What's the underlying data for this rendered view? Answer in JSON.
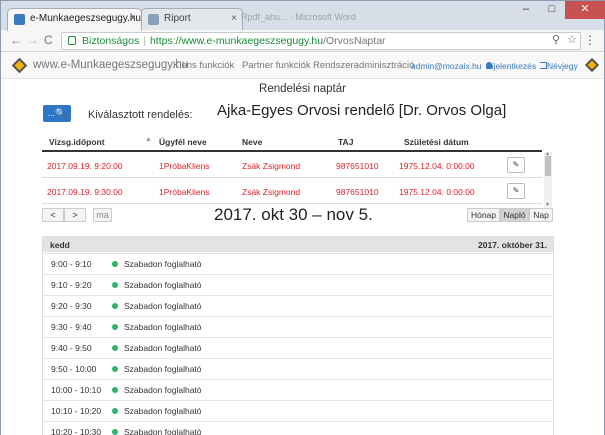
{
  "browser": {
    "tabs": [
      {
        "label": "e-Munkaegeszsegugy.hu",
        "close": "×",
        "favicon_color": "#3a7bbf"
      },
      {
        "label": "Riport",
        "close": "×",
        "favicon_color": "#8aa0b8"
      }
    ],
    "ghost_tabs_text": "Rpdf_ahu... - Microsoft Word",
    "window_buttons": {
      "minimize": "–",
      "maximize": "□",
      "close": "✕"
    },
    "nav": {
      "back": "←",
      "forward": "→",
      "reload": "C"
    },
    "address": {
      "secure_label": "Biztonságos",
      "separator": "|",
      "host": "https://www.e-munkaegeszsegugy.hu",
      "path": "/OrvosNaptar"
    },
    "omnibox_icons": {
      "search": "⚲",
      "star": "☆"
    },
    "menu": "⋮"
  },
  "navbar": {
    "brand": "www.e-Munkaegeszsegugy.hu",
    "links": [
      "Klens funkciók",
      "Partner funkciók",
      "Rendszeradminisztráció"
    ],
    "user": "admin@mozaix.hu",
    "logout": "Kijelentkezés",
    "card": "Névjegy"
  },
  "page": {
    "title": "Rendelési naptár",
    "search_button": "...🔍",
    "selected_label": "Kiválasztott rendelés:",
    "selected_value": "Ajka-Egyes Orvosi rendelő [Dr. Orvos Olga]"
  },
  "table": {
    "sort_indicator": "▲",
    "headers": [
      "Vizsg.időpont",
      "Ügyfél neve",
      "Neve",
      "TAJ",
      "Születési dátum"
    ],
    "rows": [
      {
        "time": "2017.09.19. 9:20:00",
        "client": "1PróbaKliens",
        "name": "Zsák Zsigmond",
        "taj": "987651010",
        "birth": "1975.12.04. 0:00:00",
        "edit": "✎"
      },
      {
        "time": "2017.09.19. 9:30:00",
        "client": "1PróbaKliens",
        "name": "Zsák Zsigmond",
        "taj": "987651010",
        "birth": "1975.12.04. 0:00:00",
        "edit": "✎"
      }
    ],
    "scroll_up": "▲",
    "scroll_down": "▼"
  },
  "calendar": {
    "prev": "<",
    "next": ">",
    "today": "ma",
    "title": "2017. okt 30 – nov 5.",
    "views": [
      "Hónap",
      "Napló",
      "Nap"
    ],
    "active_view": "Napló",
    "day_name": "kedd",
    "day_date": "2017. október 31.",
    "slots": [
      {
        "time": "9:00 - 9:10",
        "status": "Szabadon foglalható"
      },
      {
        "time": "9:10 - 9:20",
        "status": "Szabadon foglalható"
      },
      {
        "time": "9:20 - 9:30",
        "status": "Szabadon foglalható"
      },
      {
        "time": "9:30 - 9:40",
        "status": "Szabadon foglalható"
      },
      {
        "time": "9:40 - 9:50",
        "status": "Szabadon foglalható"
      },
      {
        "time": "9:50 - 10:00",
        "status": "Szabadon foglalható"
      },
      {
        "time": "10:00 - 10:10",
        "status": "Szabadon foglalható"
      },
      {
        "time": "10:10 - 10:20",
        "status": "Szabadon foglalható"
      },
      {
        "time": "10:20 - 10:30",
        "status": "Szabadon foglalható"
      }
    ],
    "slot_color": "#2fb36a"
  }
}
